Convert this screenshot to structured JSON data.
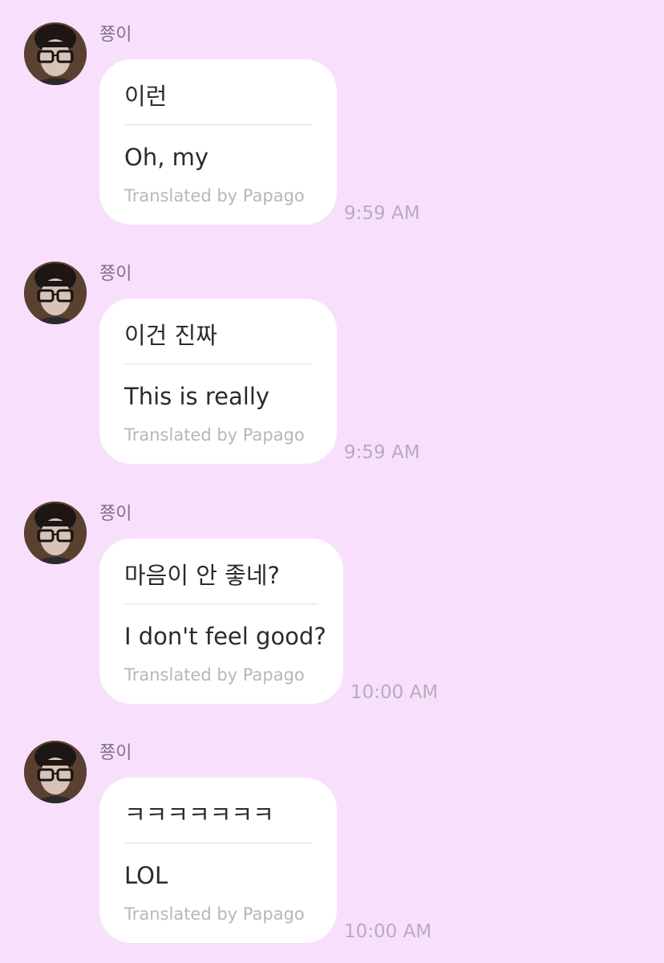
{
  "chat": {
    "messages": [
      {
        "sender": "쭁이",
        "original": "이런",
        "translated": "Oh, my",
        "credit": "Translated by Papago",
        "time": "9:59 AM"
      },
      {
        "sender": "쭁이",
        "original": "이건 진짜",
        "translated": "This is really",
        "credit": "Translated by Papago",
        "time": "9:59 AM"
      },
      {
        "sender": "쭁이",
        "original": "마음이 안 좋네?",
        "translated": "I don't feel good?",
        "credit": "Translated by Papago",
        "time": "10:00 AM"
      },
      {
        "sender": "쭁이",
        "original": "ㅋㅋㅋㅋㅋㅋㅋ",
        "translated": "LOL",
        "credit": "Translated by Papago",
        "time": "10:00 AM"
      }
    ]
  }
}
